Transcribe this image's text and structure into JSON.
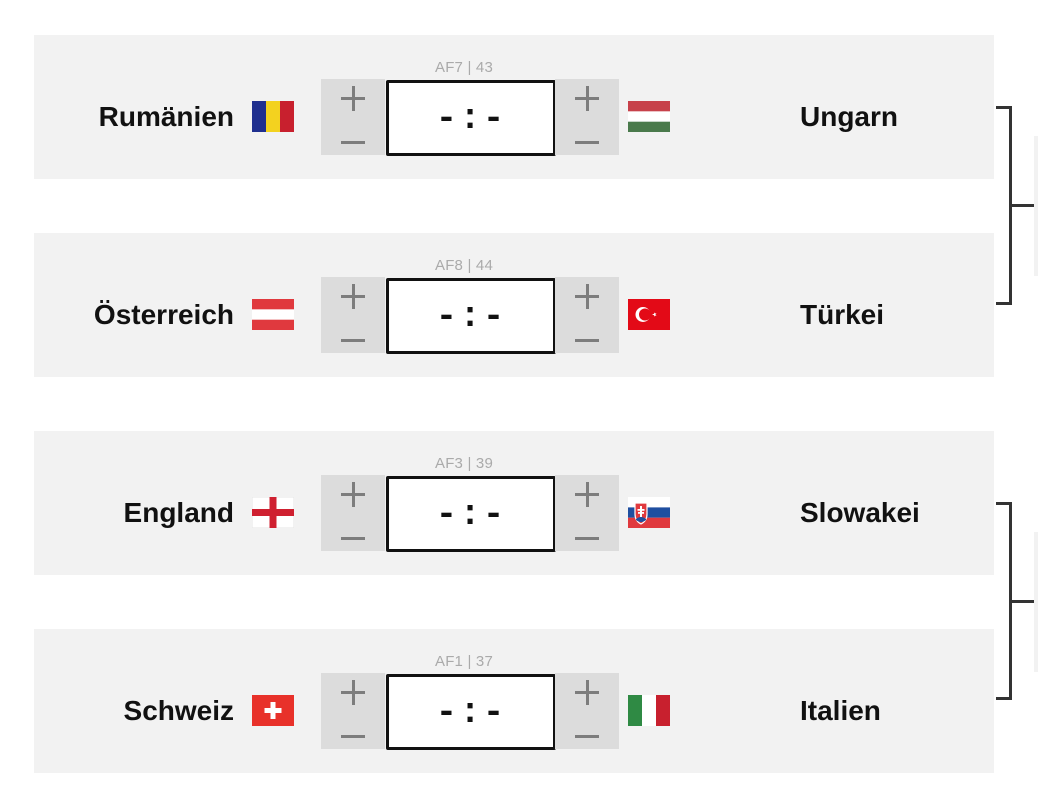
{
  "matches": [
    {
      "code": "AF7 | 43",
      "home": {
        "name": "Rumänien",
        "flag": "romania-flag"
      },
      "away": {
        "name": "Ungarn",
        "flag": "hungary-flag"
      },
      "score": "-:-"
    },
    {
      "code": "AF8 | 44",
      "home": {
        "name": "Österreich",
        "flag": "austria-flag"
      },
      "away": {
        "name": "Türkei",
        "flag": "turkey-flag"
      },
      "score": "-:-"
    },
    {
      "code": "AF3 | 39",
      "home": {
        "name": "England",
        "flag": "england-flag"
      },
      "away": {
        "name": "Slowakei",
        "flag": "slovakia-flag"
      },
      "score": "-:-"
    },
    {
      "code": "AF1 | 37",
      "home": {
        "name": "Schweiz",
        "flag": "switzerland-flag"
      },
      "away": {
        "name": "Italien",
        "flag": "italy-flag"
      },
      "score": "-:-"
    }
  ],
  "colors": {
    "card_bg": "#f2f2f2",
    "stepper_bg": "#dcdcdc",
    "bracket": "#333333"
  }
}
